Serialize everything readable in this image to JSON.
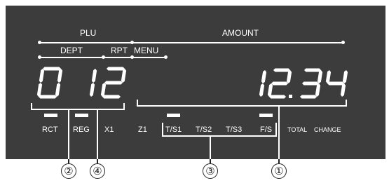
{
  "header": {
    "plu": "PLU",
    "amount": "AMOUNT",
    "dept": "DEPT",
    "rpt": "RPT",
    "menu": "MENU"
  },
  "left_display": [
    "0",
    "1",
    "2"
  ],
  "right_display": {
    "integer": "12",
    "decimal_point": ".",
    "fraction": "34"
  },
  "indicators": {
    "rct": "RCT",
    "reg": "REG",
    "x1": "X1",
    "z1": "Z1",
    "ts1": "T/S1",
    "ts2": "T/S2",
    "ts3": "T/S3",
    "fs": "F/S",
    "total": "TOTAL",
    "change": "CHANGE"
  },
  "callouts": {
    "c1": "①",
    "c2": "②",
    "c3": "③",
    "c4": "④"
  },
  "colors": {
    "panel": "#3c3c3c",
    "segment": "#ffffff",
    "callout": "#222222"
  }
}
